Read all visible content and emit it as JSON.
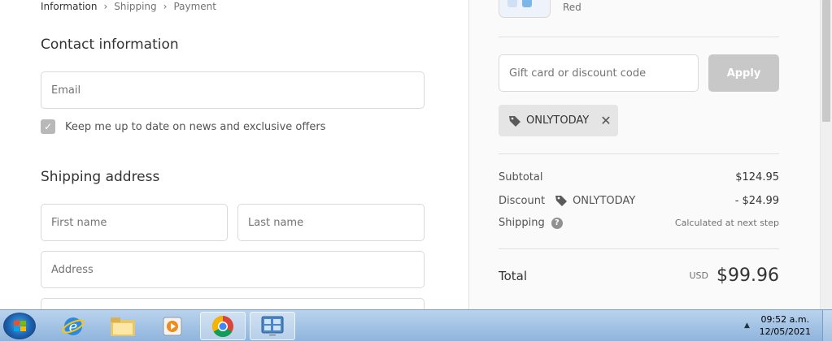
{
  "breadcrumb": {
    "items": [
      "Information",
      "Shipping",
      "Payment"
    ],
    "separator_icon": "chevron-right-icon"
  },
  "contact": {
    "title": "Contact information",
    "email_placeholder": "Email",
    "newsletter_label": "Keep me up to date on news and exclusive offers",
    "newsletter_checked": true
  },
  "shipping": {
    "title": "Shipping address",
    "first_name_placeholder": "First name",
    "last_name_placeholder": "Last name",
    "address_placeholder": "Address"
  },
  "order_summary": {
    "product_variant": "Red",
    "discount_input_placeholder": "Gift card or discount code",
    "apply_label": "Apply",
    "applied_code": "ONLYTODAY",
    "subtotal_label": "Subtotal",
    "subtotal_value": "$124.95",
    "discount_label": "Discount",
    "discount_code": "ONLYTODAY",
    "discount_value": "- $24.99",
    "shipping_label": "Shipping",
    "shipping_value": "Calculated at next step",
    "total_label": "Total",
    "total_currency": "USD",
    "total_value": "$99.96"
  },
  "taskbar": {
    "time": "09:52 a.m.",
    "date": "12/05/2021",
    "apps": [
      "internet-explorer-icon",
      "file-explorer-icon",
      "media-player-icon",
      "chrome-icon",
      "control-panel-icon"
    ],
    "active_app": "chrome-icon"
  },
  "colors": {
    "apply_disabled": "#c8c8c8",
    "chip_background": "#e5e5e5",
    "sidebar_background": "#fafafa",
    "taskbar_top": "#b9d3ee",
    "taskbar_bottom": "#8fb4dc"
  }
}
